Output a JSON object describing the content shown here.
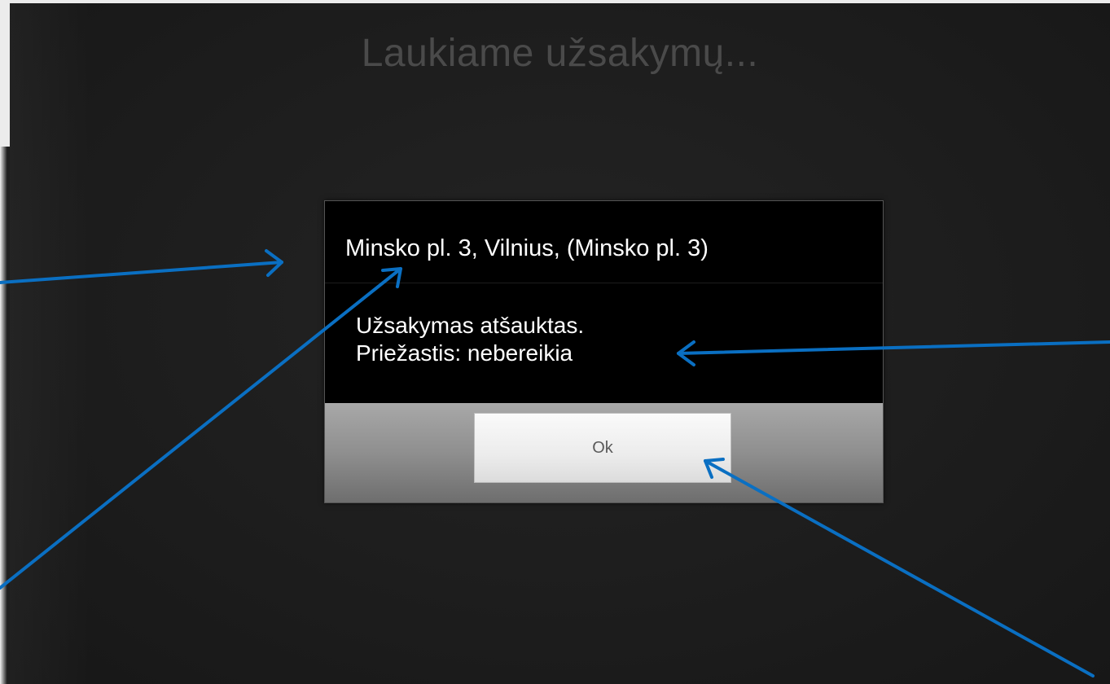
{
  "screen": {
    "title": "Laukiame užsakymų..."
  },
  "dialog": {
    "title": "Minsko pl. 3, Vilnius,  (Minsko pl. 3)",
    "message_line1": "Užsakymas atšauktas.",
    "message_line2": "Priežastis: nebereikia",
    "ok_label": "Ok"
  },
  "annotations": {
    "arrow_color": "#0a6fc2"
  },
  "colors": {
    "screen_background": "#1e1e1e",
    "dialog_background": "#000000",
    "footer_gray": "#8f8f8f",
    "button_face": "#ececec"
  }
}
